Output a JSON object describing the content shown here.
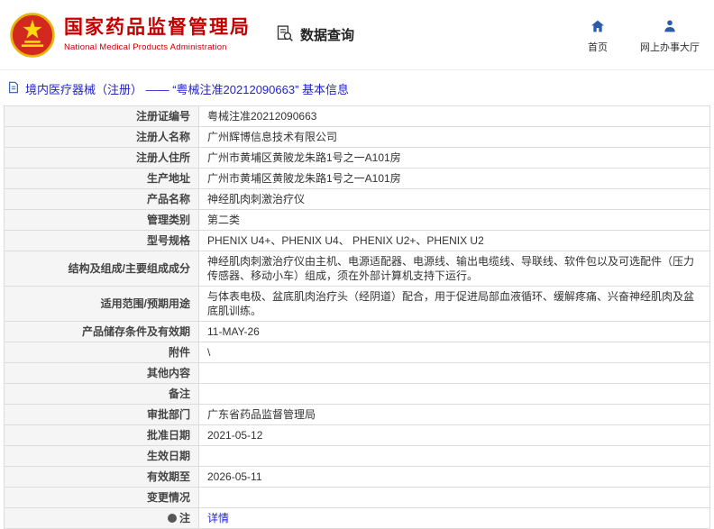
{
  "header": {
    "org_cn": "国家药品监督管理局",
    "org_en": "National Medical Products Administration",
    "section_label": "数据查询",
    "nav": [
      {
        "label": "首页"
      },
      {
        "label": "网上办事大厅"
      }
    ]
  },
  "page_title": "境内医疗器械（注册） ——  “粤械注准20212090663”  基本信息",
  "colors": {
    "brand_red": "#c30000",
    "link_blue": "#2323cc",
    "icon_blue": "#2a5caa"
  },
  "table": {
    "rows": [
      {
        "label": "注册证编号",
        "value": "粤械注准20212090663"
      },
      {
        "label": "注册人名称",
        "value": "广州辉博信息技术有限公司"
      },
      {
        "label": "注册人住所",
        "value": "广州市黄埔区黄陂龙朱路1号之一A101房"
      },
      {
        "label": "生产地址",
        "value": "广州市黄埔区黄陂龙朱路1号之一A101房"
      },
      {
        "label": "产品名称",
        "value": "神经肌肉刺激治疗仪"
      },
      {
        "label": "管理类别",
        "value": "第二类"
      },
      {
        "label": "型号规格",
        "value": "PHENIX U4+、PHENIX U4、 PHENIX U2+、PHENIX U2"
      },
      {
        "label": "结构及组成/主要组成成分",
        "value": "神经肌肉刺激治疗仪由主机、电源适配器、电源线、输出电缆线、导联线、软件包以及可选配件（压力传感器、移动小车）组成，须在外部计算机支持下运行。"
      },
      {
        "label": "适用范围/预期用途",
        "value": "与体表电极、盆底肌肉治疗头（经阴道）配合，用于促进局部血液循环、缓解疼痛、兴奋神经肌肉及盆底肌训练。"
      },
      {
        "label": "产品储存条件及有效期",
        "value": "11-MAY-26"
      },
      {
        "label": "附件",
        "value": "\\"
      },
      {
        "label": "其他内容",
        "value": ""
      },
      {
        "label": "备注",
        "value": ""
      },
      {
        "label": "审批部门",
        "value": "广东省药品监督管理局"
      },
      {
        "label": "批准日期",
        "value": "2021-05-12"
      },
      {
        "label": "生效日期",
        "value": ""
      },
      {
        "label": "有效期至",
        "value": "2026-05-11"
      },
      {
        "label": "变更情况",
        "value": ""
      },
      {
        "label": "注",
        "value": "详情"
      }
    ]
  }
}
